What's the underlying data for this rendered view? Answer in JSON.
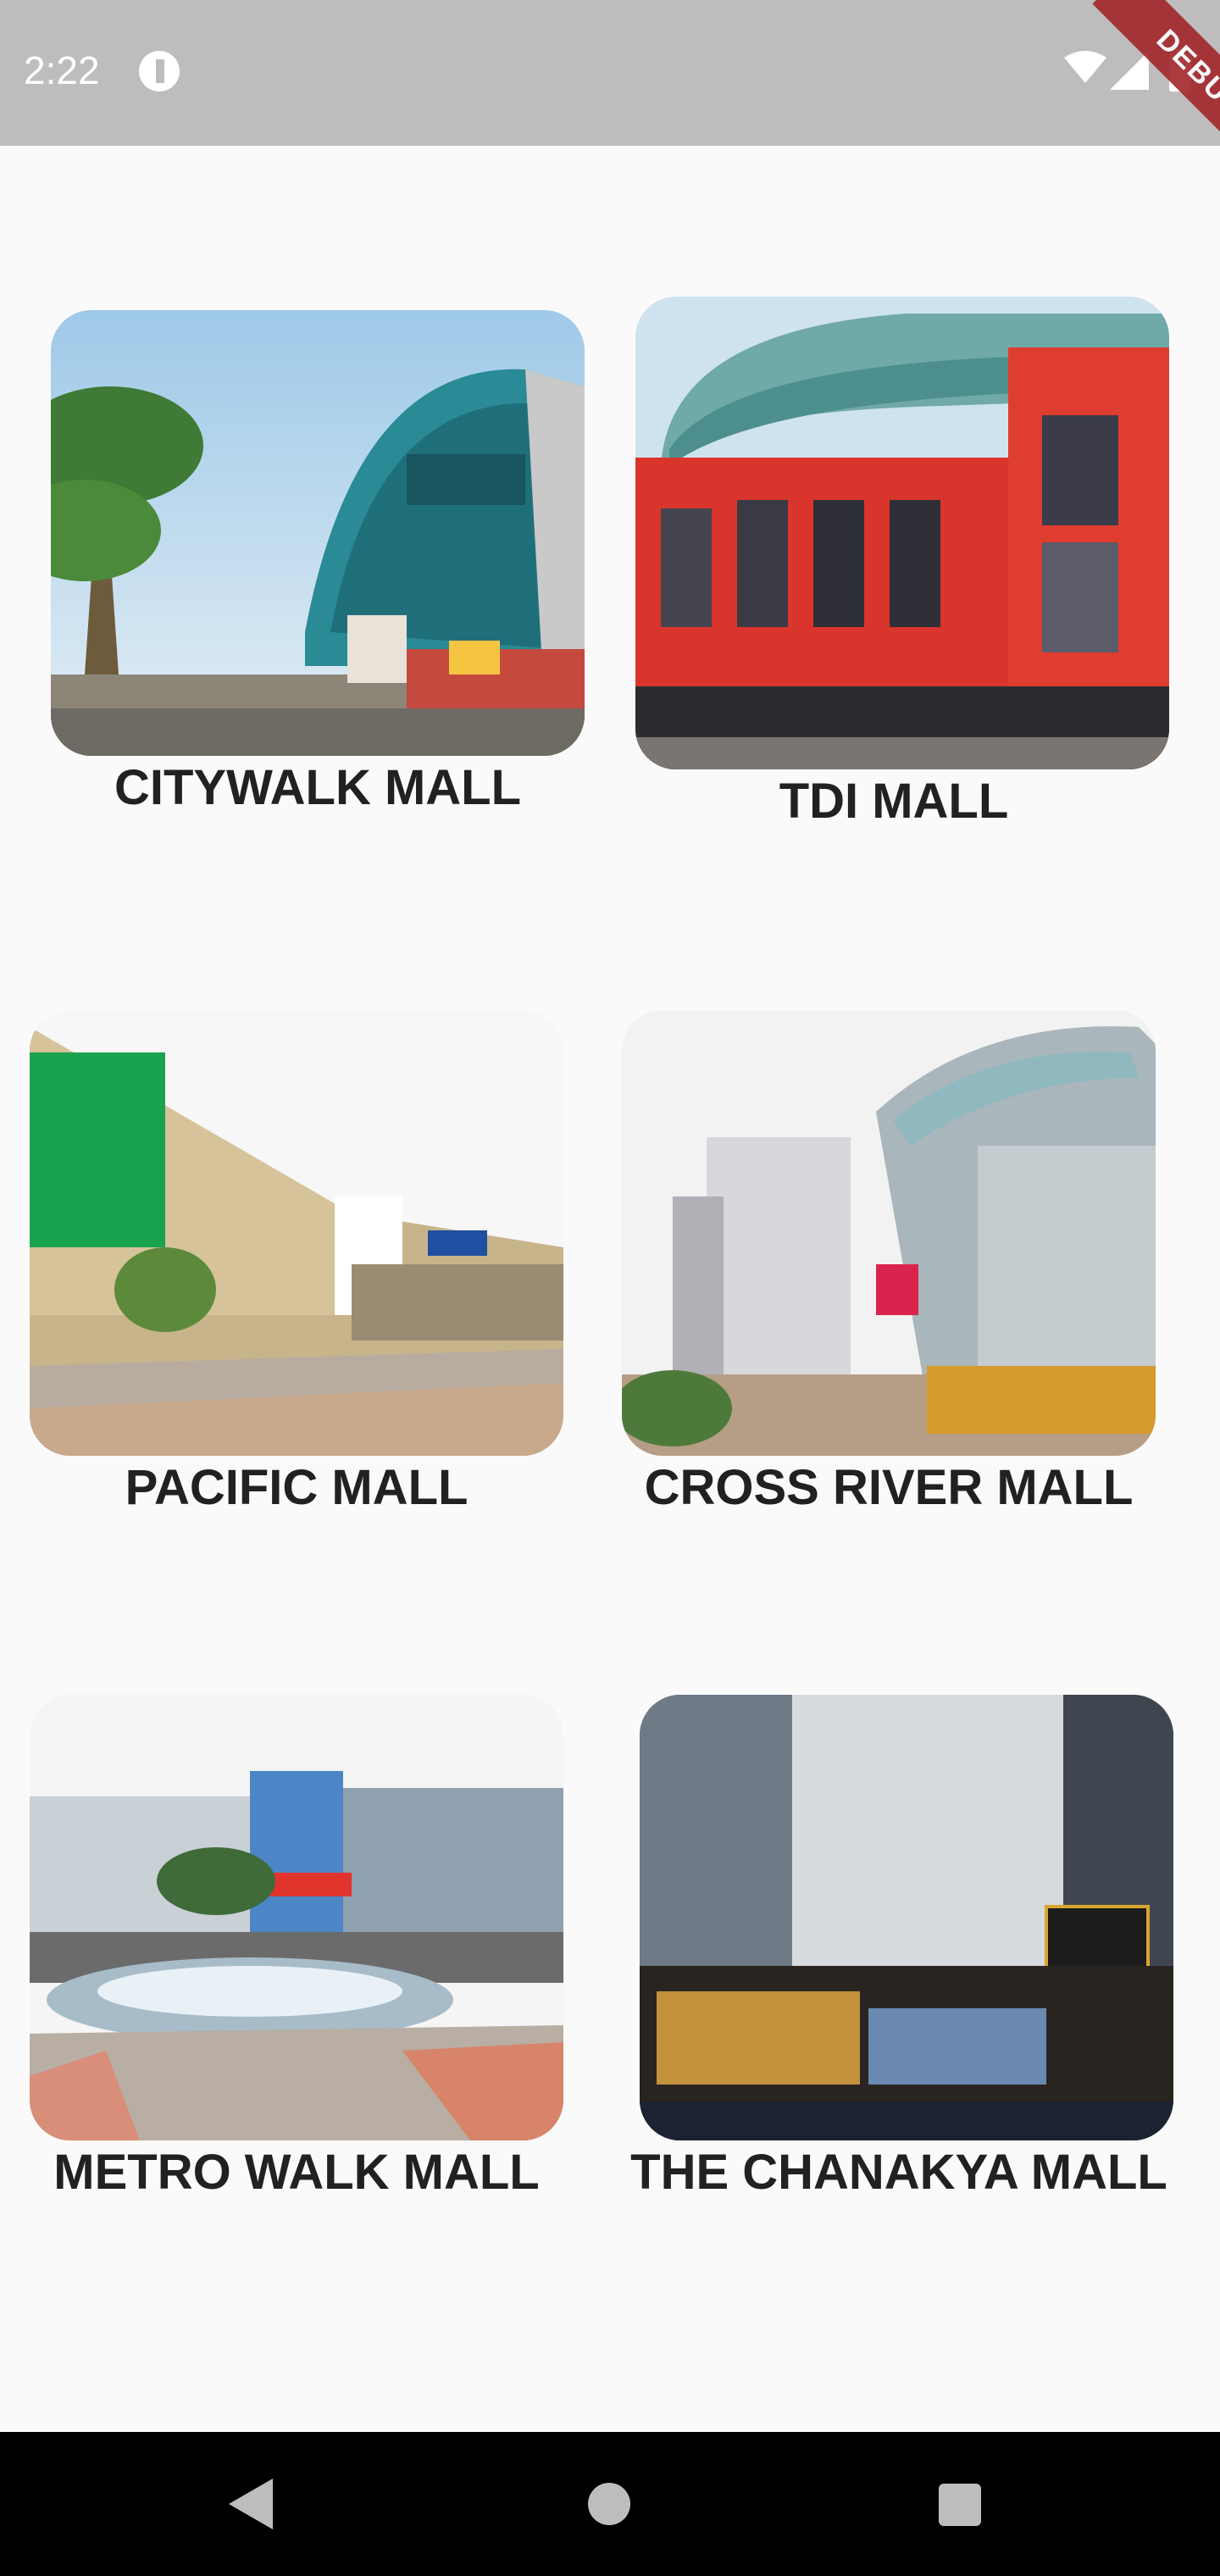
{
  "status_bar": {
    "time": "2:22",
    "debug_label": "DEBUG",
    "icons": [
      "app-notification-icon",
      "wifi-icon",
      "signal-icon",
      "battery-icon"
    ]
  },
  "malls": [
    {
      "name": "CITYWALK MALL"
    },
    {
      "name": "TDI MALL"
    },
    {
      "name": "PACIFIC MALL"
    },
    {
      "name": "CROSS RIVER MALL"
    },
    {
      "name": "METRO WALK MALL"
    },
    {
      "name": "THE CHANAKYA MALL"
    }
  ],
  "nav_bar": {
    "icons": [
      "back-icon",
      "home-icon",
      "recent-apps-icon"
    ]
  }
}
